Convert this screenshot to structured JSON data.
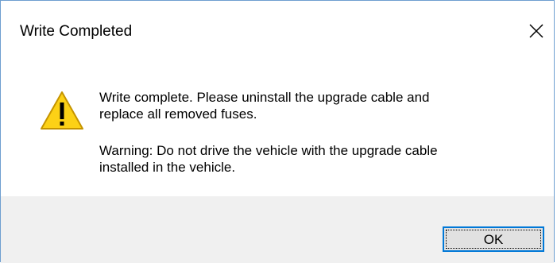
{
  "window": {
    "title": "Write Completed",
    "close_icon": "close-icon"
  },
  "message": {
    "icon": "warning-icon",
    "line1": "Write complete. Please uninstall the upgrade cable and\nreplace all removed fuses.",
    "line2": "Warning: Do not drive the vehicle with the upgrade cable\ninstalled in the vehicle."
  },
  "buttons": {
    "ok_label": "OK"
  },
  "colors": {
    "border": "#6e9fd0",
    "footer_bg": "#f0f0f0",
    "button_bg": "#e1e1e1",
    "button_focus_border": "#0078d7",
    "warning_fill": "#fcd116",
    "warning_stroke": "#c59400"
  }
}
